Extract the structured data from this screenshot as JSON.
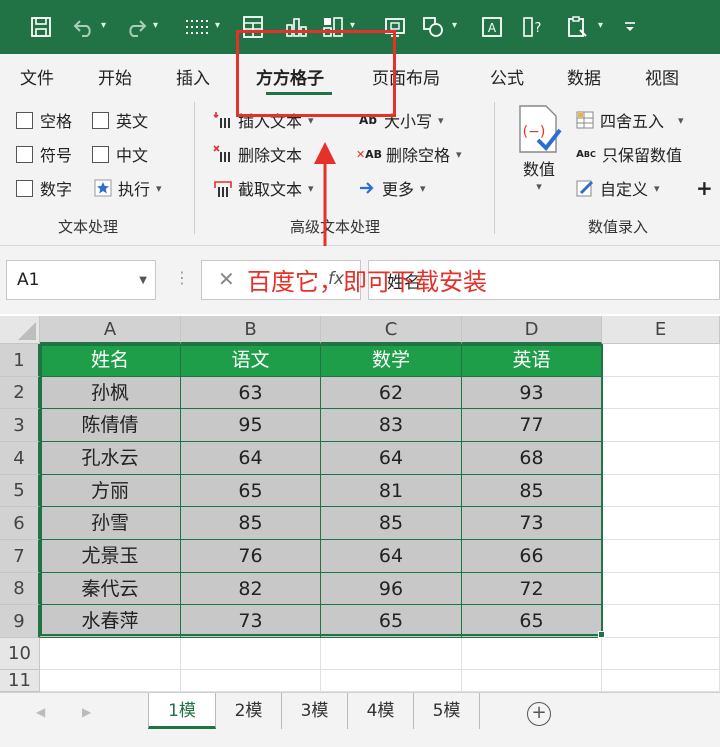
{
  "ribbon": {
    "tabs": [
      "文件",
      "开始",
      "插入",
      "方方格子",
      "页面布局",
      "公式",
      "数据",
      "视图"
    ],
    "text_group": {
      "checkboxes": [
        "空格",
        "英文",
        "符号",
        "中文",
        "数字"
      ],
      "execute": "执行",
      "label": "文本处理"
    },
    "advanced_group": {
      "insert_text": "插入文本",
      "delete_text": "删除文本",
      "extract_text": "截取文本",
      "case": "大小写",
      "delete_spaces": "删除空格",
      "more": "更多",
      "label": "高级文本处理"
    },
    "value_group": {
      "value": "数值",
      "round": "四舍五入",
      "keep_values": "只保留数值",
      "custom": "自定义",
      "label": "数值录入"
    }
  },
  "annotation": {
    "text": "百度它，即可下载安装",
    "color": "#e4322b"
  },
  "formula_bar": {
    "name_box": "A1",
    "content": "姓名"
  },
  "sheet": {
    "columns": [
      "A",
      "B",
      "C",
      "D",
      "E"
    ],
    "rows": [
      "1",
      "2",
      "3",
      "4",
      "5",
      "6",
      "7",
      "8",
      "9",
      "10",
      "11"
    ],
    "header": [
      "姓名",
      "语文",
      "数学",
      "英语"
    ],
    "data": [
      [
        "孙枫",
        "63",
        "62",
        "93"
      ],
      [
        "陈倩倩",
        "95",
        "83",
        "77"
      ],
      [
        "孔水云",
        "64",
        "64",
        "68"
      ],
      [
        "方丽",
        "65",
        "81",
        "85"
      ],
      [
        "孙雪",
        "85",
        "85",
        "73"
      ],
      [
        "尤景玉",
        "76",
        "64",
        "66"
      ],
      [
        "秦代云",
        "82",
        "96",
        "72"
      ],
      [
        "水春萍",
        "73",
        "65",
        "65"
      ]
    ]
  },
  "sheet_tabs": [
    "1模",
    "2模",
    "3模",
    "4模",
    "5模"
  ],
  "colors": {
    "accent": "#217346",
    "table_header": "#1e9e49"
  }
}
